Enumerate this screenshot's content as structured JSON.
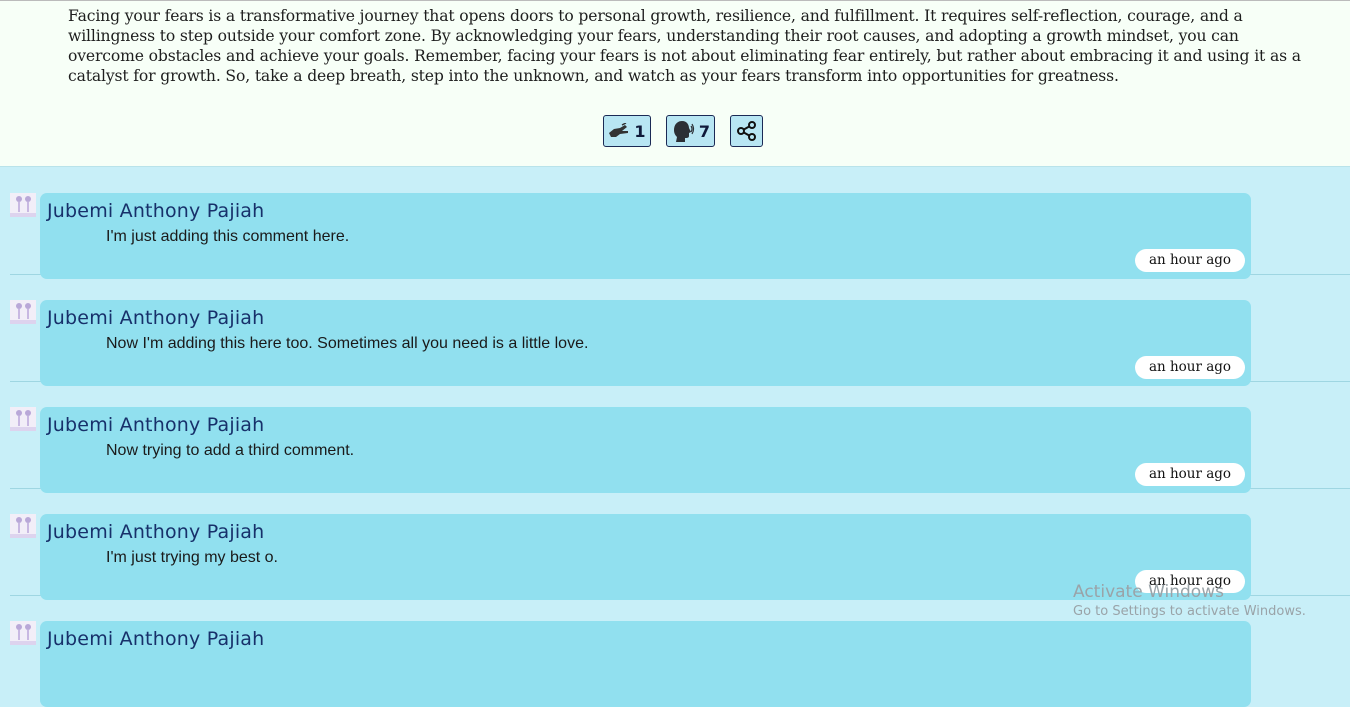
{
  "article": {
    "paragraph": "Facing your fears is a transformative journey that opens doors to personal growth, resilience, and fulfillment. It requires self-reflection, courage, and a willingness to step outside your comfort zone. By acknowledging your fears, understanding their root causes, and adopting a growth mindset, you can overcome obstacles and achieve your goals. Remember, facing your fears is not about eliminating fear entirely, but rather about embracing it and using it as a catalyst for growth. So, take a deep breath, step into the unknown, and watch as your fears transform into opportunities for greatness."
  },
  "actions": {
    "praise": {
      "icon": "praise-hand-icon",
      "count": "1"
    },
    "comments": {
      "icon": "speaking-head-icon",
      "count": "7"
    },
    "share": {
      "icon": "share-icon"
    }
  },
  "comments": [
    {
      "author": "Jubemi Anthony Pajiah",
      "text": "I'm just adding this comment here.",
      "time": "an hour ago"
    },
    {
      "author": "Jubemi Anthony Pajiah",
      "text": "Now I'm adding this here too. Sometimes all you need is a little love.",
      "time": "an hour ago"
    },
    {
      "author": "Jubemi Anthony Pajiah",
      "text": "Now trying to add a third comment.",
      "time": "an hour ago"
    },
    {
      "author": "Jubemi Anthony Pajiah",
      "text": "I'm just trying my best o.",
      "time": "an hour ago"
    },
    {
      "author": "Jubemi Anthony Pajiah",
      "text": "",
      "time": ""
    }
  ],
  "watermark": {
    "title": "Activate Windows",
    "subtitle": "Go to Settings to activate Windows."
  },
  "colors": {
    "page_background": "#c8eff8",
    "article_background": "#f7fff7",
    "comment_bubble": "#91e0ef",
    "author_text": "#17306a",
    "button_border": "#1b2a55"
  }
}
